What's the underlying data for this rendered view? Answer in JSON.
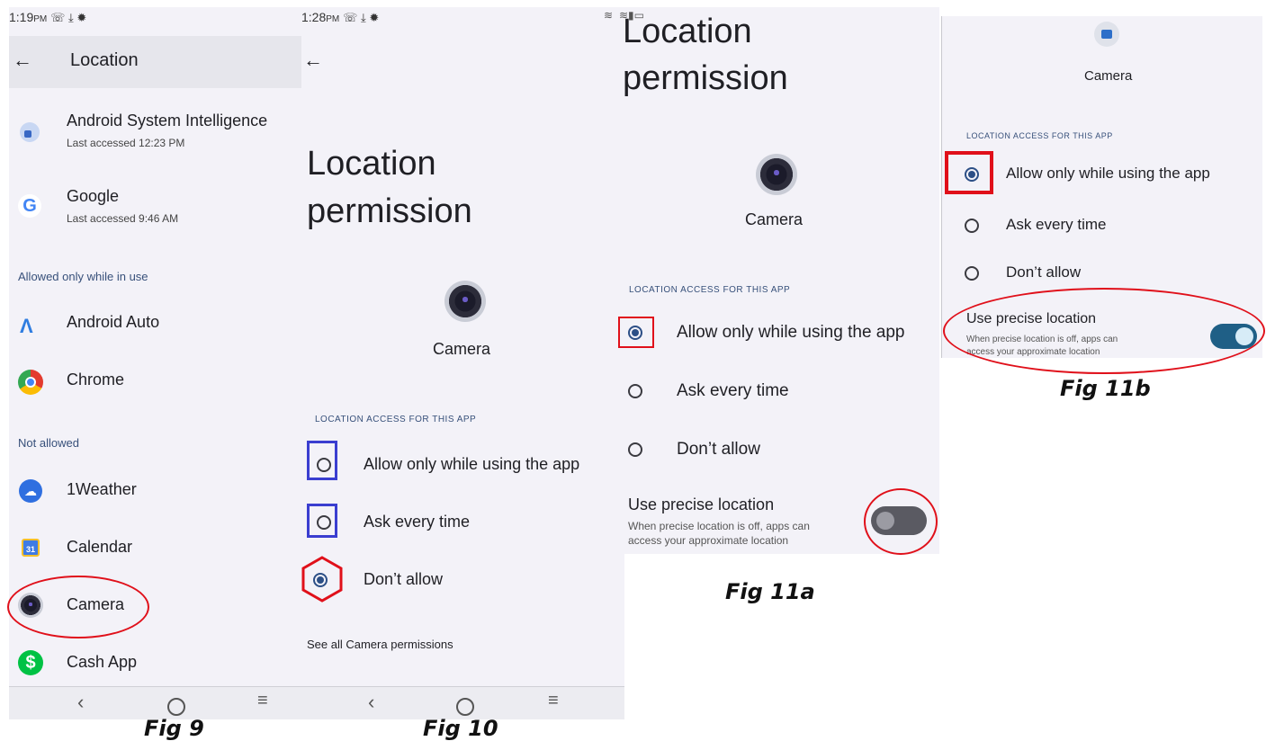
{
  "fig9": {
    "status_time": "1:19",
    "status_ampm": "PM",
    "title": "Location",
    "items_top": [
      {
        "name": "Android System Intelligence",
        "sub": "Last accessed 12:23 PM"
      },
      {
        "name": "Google",
        "sub": "Last accessed 9:46 AM"
      }
    ],
    "section_allowed": "Allowed only while in use",
    "items_allowed": [
      "Android Auto",
      "Chrome"
    ],
    "section_not_allowed": "Not allowed",
    "items_not_allowed": [
      "1Weather",
      "Calendar",
      "Camera",
      "Cash App"
    ],
    "caption": "Fig 9"
  },
  "fig10": {
    "status_time": "1:28",
    "status_ampm": "PM",
    "title_line1": "Location",
    "title_line2": "permission",
    "app_name": "Camera",
    "section": "LOCATION ACCESS FOR THIS APP",
    "options": [
      "Allow only while using the app",
      "Ask every time",
      "Don’t allow"
    ],
    "selected": 2,
    "see_all": "See all Camera permissions",
    "caption": "Fig 10"
  },
  "fig11a": {
    "title_line1": "Location",
    "title_line2": "permission",
    "app_name": "Camera",
    "section": "LOCATION ACCESS FOR THIS APP",
    "options": [
      "Allow only while using the app",
      "Ask every time",
      "Don’t allow"
    ],
    "selected": 0,
    "precise_title": "Use precise location",
    "precise_desc_1": "When precise location is off, apps can",
    "precise_desc_2": "access your approximate location",
    "precise_on": false,
    "caption": "Fig 11a"
  },
  "fig11b": {
    "app_name": "Camera",
    "section": "LOCATION ACCESS FOR THIS APP",
    "options": [
      "Allow only while using the app",
      "Ask every time",
      "Don’t allow"
    ],
    "selected": 0,
    "precise_title": "Use precise location",
    "precise_desc_1": "When precise location is off, apps can",
    "precise_desc_2": "access your approximate location",
    "precise_on": true,
    "caption": "Fig 11b"
  },
  "colors": {
    "panel_bg": "#f3f2f8",
    "accent": "#2c4f86",
    "annotation_red": "#e0101a",
    "annotation_blue": "#3a3ed0"
  }
}
